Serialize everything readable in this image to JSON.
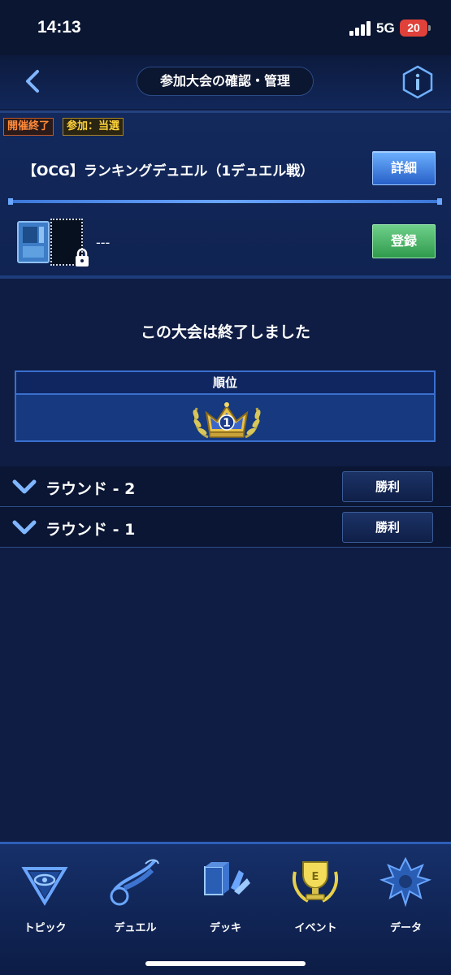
{
  "status_bar": {
    "time": "14:13",
    "network": "5G",
    "battery": "20"
  },
  "header": {
    "title": "参加大会の確認・管理"
  },
  "event": {
    "tag_status": "開催終了",
    "tag_entry": "参加：当選",
    "name": "【OCG】ランキングデュエル（1デュエル戦）",
    "details_label": "詳細",
    "deck_value": "---",
    "register_label": "登録"
  },
  "main": {
    "ended_message": "この大会は終了しました",
    "rank_header": "順位",
    "rank_value": "1"
  },
  "rounds": [
    {
      "label": "ラウンド - 2",
      "result": "勝利"
    },
    {
      "label": "ラウンド - 1",
      "result": "勝利"
    }
  ],
  "nav": [
    {
      "label": "トピック",
      "icon": "millennium-eye-icon"
    },
    {
      "label": "デュエル",
      "icon": "duel-bike-icon"
    },
    {
      "label": "デッキ",
      "icon": "deck-cards-icon"
    },
    {
      "label": "イベント",
      "icon": "trophy-icon",
      "active": true
    },
    {
      "label": "データ",
      "icon": "data-character-icon"
    }
  ],
  "colors": {
    "background": "#0f1d44",
    "accent": "#3a6fcf",
    "details": "#2860c8",
    "register": "#2f9a4c",
    "battery": "#e0413a"
  }
}
